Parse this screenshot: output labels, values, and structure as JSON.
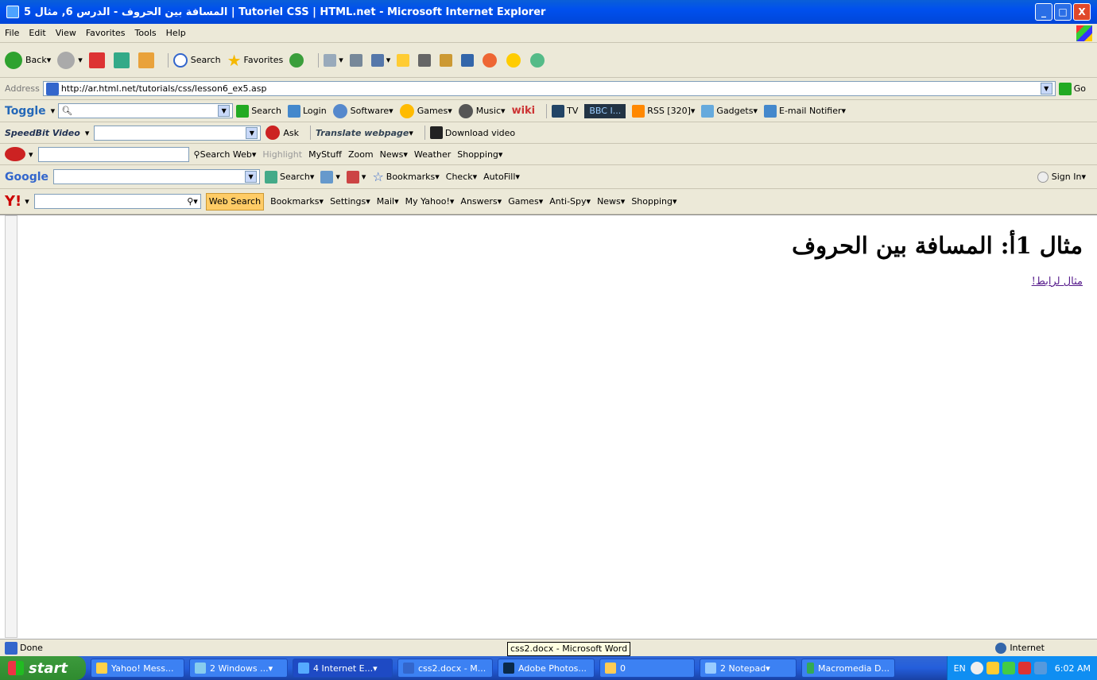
{
  "window": {
    "title": "المسافة بين الحروف - الدرس 6, مثال 5 | Tutoriel CSS | HTML.net - Microsoft Internet Explorer",
    "minimize": "_",
    "maximize": "□",
    "close": "X"
  },
  "menu": [
    "File",
    "Edit",
    "View",
    "Favorites",
    "Tools",
    "Help"
  ],
  "toolbar": {
    "back": "Back",
    "search": "Search",
    "favorites": "Favorites"
  },
  "address": {
    "label": "Address",
    "url": "http://ar.html.net/tutorials/css/lesson6_ex5.asp",
    "go": "Go"
  },
  "toggle_bar": {
    "brand": "Toggle",
    "search": "Search",
    "login": "Login",
    "software": "Software",
    "games": "Games",
    "music": "Music",
    "wiki": "wiki",
    "tv": "TV",
    "player": "BBC I...",
    "rss": "RSS [320]",
    "gadgets": "Gadgets",
    "email": "E-mail Notifier"
  },
  "speedbit_bar": {
    "brand": "SpeedBit Video",
    "ask": "Ask",
    "translate": "Translate webpage",
    "download": "Download video"
  },
  "ask_bar": {
    "search_web": "Search Web",
    "highlight": "Highlight",
    "mystuff": "MyStuff",
    "zoom": "Zoom",
    "news": "News",
    "weather": "Weather",
    "shopping": "Shopping"
  },
  "google_bar": {
    "brand": "Google",
    "search": "Search",
    "bookmarks": "Bookmarks",
    "check": "Check",
    "autofill": "AutoFill",
    "sign_in": "Sign In"
  },
  "yahoo_bar": {
    "brand": "Y!",
    "web_search": "Web Search",
    "bookmarks": "Bookmarks",
    "settings": "Settings",
    "mail": "Mail",
    "my_yahoo": "My Yahoo!",
    "answers": "Answers",
    "games": "Games",
    "antispy": "Anti-Spy",
    "news": "News",
    "shopping": "Shopping"
  },
  "page": {
    "heading": "مثال 1أ: المسافة بين الحروف",
    "link": "مثال لرابط!"
  },
  "status": {
    "text": "Done",
    "zone": "Internet",
    "tooltip": "css2.docx - Microsoft Word"
  },
  "taskbar": {
    "start": "start",
    "tasks": [
      "Yahoo! Mess...",
      "2 Windows ...",
      "4 Internet E...",
      "css2.docx - M...",
      "Adobe Photos...",
      "0",
      "2 Notepad",
      "Macromedia D..."
    ],
    "lang": "EN",
    "clock": "6:02 AM"
  }
}
